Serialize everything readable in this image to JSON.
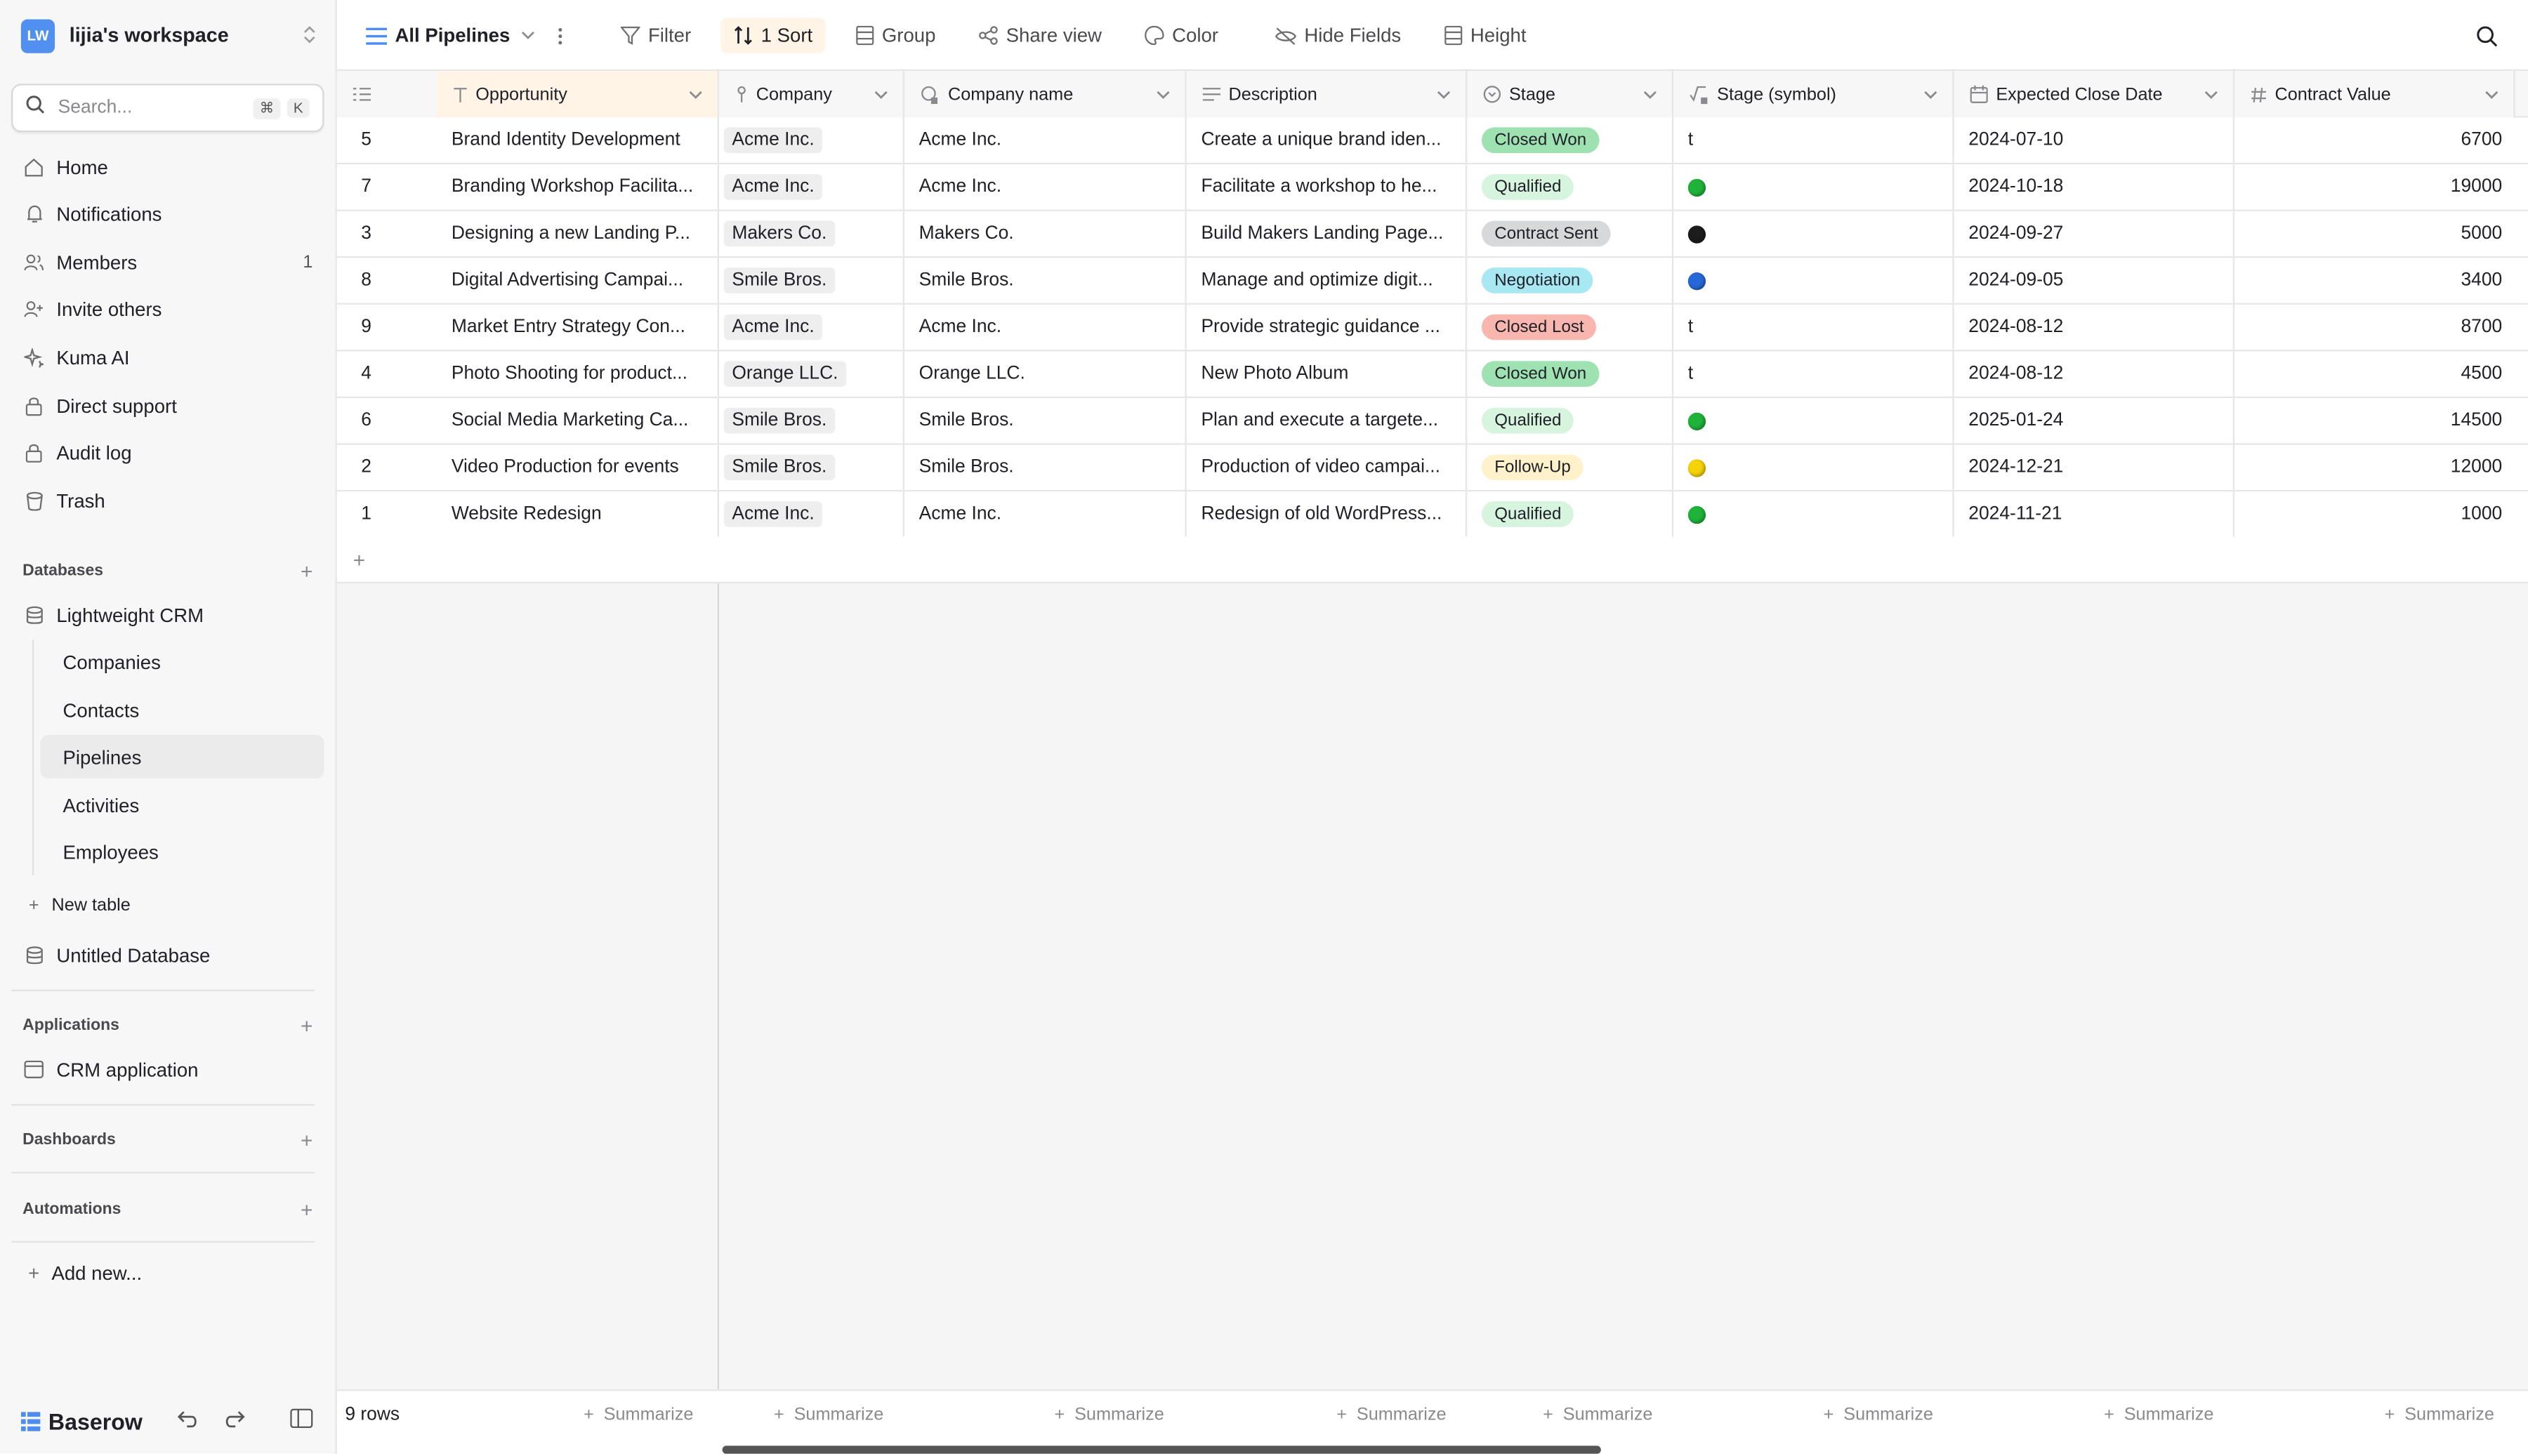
{
  "workspace": {
    "badge": "LW",
    "name": "lijia's workspace"
  },
  "search": {
    "placeholder": "Search...",
    "kbd1": "⌘",
    "kbd2": "K"
  },
  "nav": [
    {
      "label": "Home",
      "icon": "home-icon"
    },
    {
      "label": "Notifications",
      "icon": "bell-icon"
    },
    {
      "label": "Members",
      "icon": "users-icon",
      "count": "1"
    },
    {
      "label": "Invite others",
      "icon": "user-plus-icon"
    },
    {
      "label": "Kuma AI",
      "icon": "sparkle-icon"
    },
    {
      "label": "Direct support",
      "icon": "lock-icon"
    },
    {
      "label": "Audit log",
      "icon": "lock-icon"
    },
    {
      "label": "Trash",
      "icon": "trash-icon"
    }
  ],
  "databases": {
    "heading": "Databases",
    "db_name": "Lightweight CRM",
    "tables": [
      "Companies",
      "Contacts",
      "Pipelines",
      "Activities",
      "Employees"
    ],
    "active_table": "Pipelines",
    "new_table": "New table",
    "other_db": "Untitled Database"
  },
  "applications": {
    "heading": "Applications",
    "items": [
      "CRM application"
    ]
  },
  "dashboards": {
    "heading": "Dashboards"
  },
  "automations": {
    "heading": "Automations"
  },
  "add_new": "Add new...",
  "footer": {
    "brand": "Baserow",
    "rows": "9 rows",
    "summarize": "Summarize"
  },
  "toolbar": {
    "view": "All Pipelines",
    "filter": "Filter",
    "sort": "1 Sort",
    "group": "Group",
    "share": "Share view",
    "color": "Color",
    "hide": "Hide Fields",
    "height": "Height"
  },
  "columns": {
    "opportunity": "Opportunity",
    "company": "Company",
    "company_name": "Company name",
    "description": "Description",
    "stage": "Stage",
    "stage_symbol": "Stage (symbol)",
    "close_date": "Expected Close Date",
    "value": "Contract Value"
  },
  "colors": {
    "accent": "#5190ef",
    "sort_highlight": "#fff4e5",
    "closed_won": "#9fe2b2",
    "qualified": "#d7f4de",
    "contract_sent": "#d7d8d9",
    "negotiation": "#a8e8f3",
    "closed_lost": "#f9b6ae",
    "follow_up": "#fff1c9"
  },
  "rows": [
    {
      "id": "5",
      "opportunity": "Brand Identity Development",
      "company": "Acme Inc.",
      "company_name": "Acme Inc.",
      "description": "Create a unique brand iden...",
      "stage": "Closed Won",
      "stage_key": "closed_won",
      "symbol": "t",
      "symbol_type": "text",
      "close_date": "2024-07-10",
      "value": "6700"
    },
    {
      "id": "7",
      "opportunity": "Branding Workshop Facilita...",
      "company": "Acme Inc.",
      "company_name": "Acme Inc.",
      "description": "Facilitate a workshop to he...",
      "stage": "Qualified",
      "stage_key": "qualified",
      "symbol": "green",
      "symbol_type": "dot",
      "close_date": "2024-10-18",
      "value": "19000"
    },
    {
      "id": "3",
      "opportunity": "Designing a new Landing P...",
      "company": "Makers Co.",
      "company_name": "Makers Co.",
      "description": "Build Makers Landing Page...",
      "stage": "Contract Sent",
      "stage_key": "contract_sent",
      "symbol": "black",
      "symbol_type": "dot",
      "close_date": "2024-09-27",
      "value": "5000"
    },
    {
      "id": "8",
      "opportunity": "Digital Advertising Campai...",
      "company": "Smile Bros.",
      "company_name": "Smile Bros.",
      "description": "Manage and optimize digit...",
      "stage": "Negotiation",
      "stage_key": "negotiation",
      "symbol": "blue",
      "symbol_type": "dot",
      "close_date": "2024-09-05",
      "value": "3400"
    },
    {
      "id": "9",
      "opportunity": "Market Entry Strategy Con...",
      "company": "Acme Inc.",
      "company_name": "Acme Inc.",
      "description": "Provide strategic guidance ...",
      "stage": "Closed Lost",
      "stage_key": "closed_lost",
      "symbol": "t",
      "symbol_type": "text",
      "close_date": "2024-08-12",
      "value": "8700"
    },
    {
      "id": "4",
      "opportunity": "Photo Shooting for product...",
      "company": "Orange LLC.",
      "company_name": "Orange LLC.",
      "description": "New Photo Album",
      "stage": "Closed Won",
      "stage_key": "closed_won",
      "symbol": "t",
      "symbol_type": "text",
      "close_date": "2024-08-12",
      "value": "4500"
    },
    {
      "id": "6",
      "opportunity": "Social Media Marketing Ca...",
      "company": "Smile Bros.",
      "company_name": "Smile Bros.",
      "description": "Plan and execute a targete...",
      "stage": "Qualified",
      "stage_key": "qualified",
      "symbol": "green",
      "symbol_type": "dot",
      "close_date": "2025-01-24",
      "value": "14500"
    },
    {
      "id": "2",
      "opportunity": "Video Production for events",
      "company": "Smile Bros.",
      "company_name": "Smile Bros.",
      "description": "Production of video campai...",
      "stage": "Follow-Up",
      "stage_key": "follow_up",
      "symbol": "yellow",
      "symbol_type": "dot",
      "close_date": "2024-12-21",
      "value": "12000"
    },
    {
      "id": "1",
      "opportunity": "Website Redesign",
      "company": "Acme Inc.",
      "company_name": "Acme Inc.",
      "description": "Redesign of old WordPress...",
      "stage": "Qualified",
      "stage_key": "qualified",
      "symbol": "green",
      "symbol_type": "dot",
      "close_date": "2024-11-21",
      "value": "1000"
    }
  ]
}
